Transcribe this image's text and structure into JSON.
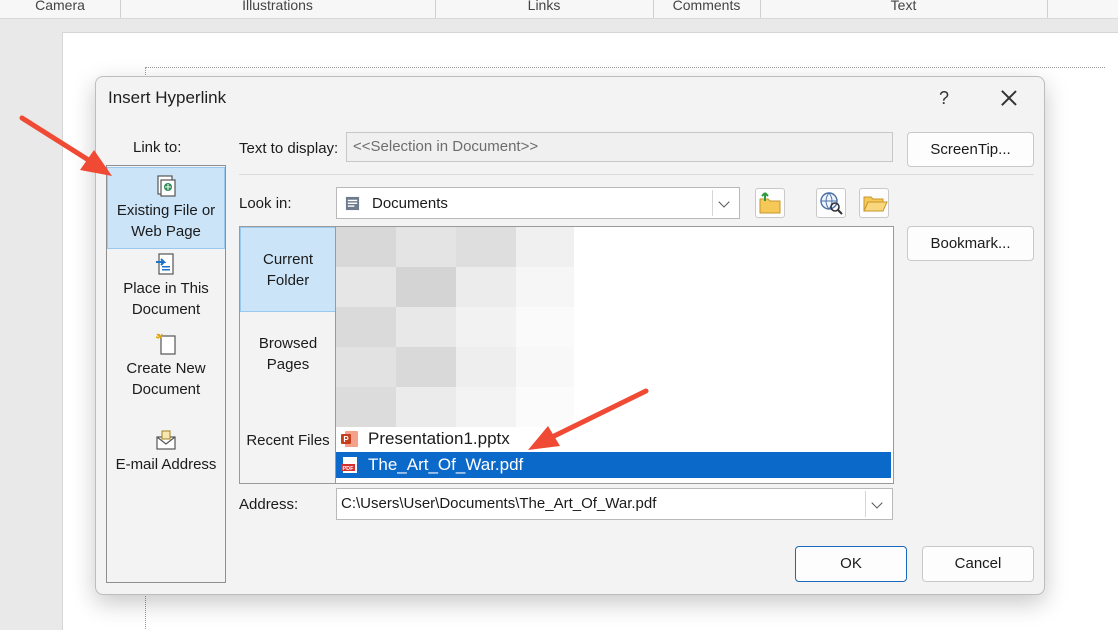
{
  "ribbon": {
    "groups": [
      "Camera",
      "Illustrations",
      "Links",
      "Comments",
      "Text"
    ]
  },
  "dialog": {
    "title": "Insert Hyperlink",
    "help_label": "?",
    "link_to_label": "Link to:",
    "link_to_items": [
      {
        "label": "Existing File or Web Page",
        "icon": "existing-file-icon",
        "selected": true
      },
      {
        "label": "Place in This Document",
        "icon": "place-in-document-icon",
        "selected": false
      },
      {
        "label": "Create New Document",
        "icon": "new-document-icon",
        "selected": false
      },
      {
        "label": "E-mail Address",
        "icon": "email-icon",
        "selected": false
      }
    ],
    "text_to_display": {
      "label": "Text to display:",
      "value": "<<Selection in Document>>"
    },
    "screentip_label": "ScreenTip...",
    "look_in": {
      "label": "Look in:",
      "value": "Documents"
    },
    "bookmark_label": "Bookmark...",
    "nav_items": [
      {
        "label": "Current Folder",
        "selected": true
      },
      {
        "label": "Browsed Pages",
        "selected": false
      },
      {
        "label": "Recent Files",
        "selected": false
      }
    ],
    "files": [
      {
        "name": "Presentation1.pptx",
        "icon": "powerpoint-file-icon",
        "selected": false
      },
      {
        "name": "The_Art_Of_War.pdf",
        "icon": "pdf-file-icon",
        "selected": true
      }
    ],
    "address": {
      "label": "Address:",
      "value": "C:\\Users\\User\\Documents\\The_Art_Of_War.pdf"
    },
    "ok_label": "OK",
    "cancel_label": "Cancel"
  },
  "colors": {
    "selection_blue": "#0b69c9",
    "nav_selected": "#cce4f7",
    "annotation_arrow": "#f04a34"
  }
}
